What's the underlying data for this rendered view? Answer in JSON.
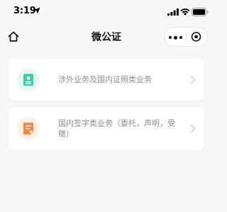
{
  "status_bar": {
    "time": "3:19"
  },
  "nav": {
    "title": "微公证"
  },
  "services": [
    {
      "label": "涉外业务及国内证照类业务",
      "icon": "document-card-icon",
      "icon_bg": "#e6f7f3",
      "icon_color": "#3cc9a6"
    },
    {
      "label": "国内签字类业务（委托，声明，受赠）",
      "icon": "signed-document-icon",
      "icon_bg": "#fdeee4",
      "icon_color": "#f08a4b"
    }
  ],
  "colors": {
    "background": "#f7f7f7",
    "card": "#ffffff",
    "label_text": "#8c8c8c",
    "chevron": "#c8c8c8"
  }
}
